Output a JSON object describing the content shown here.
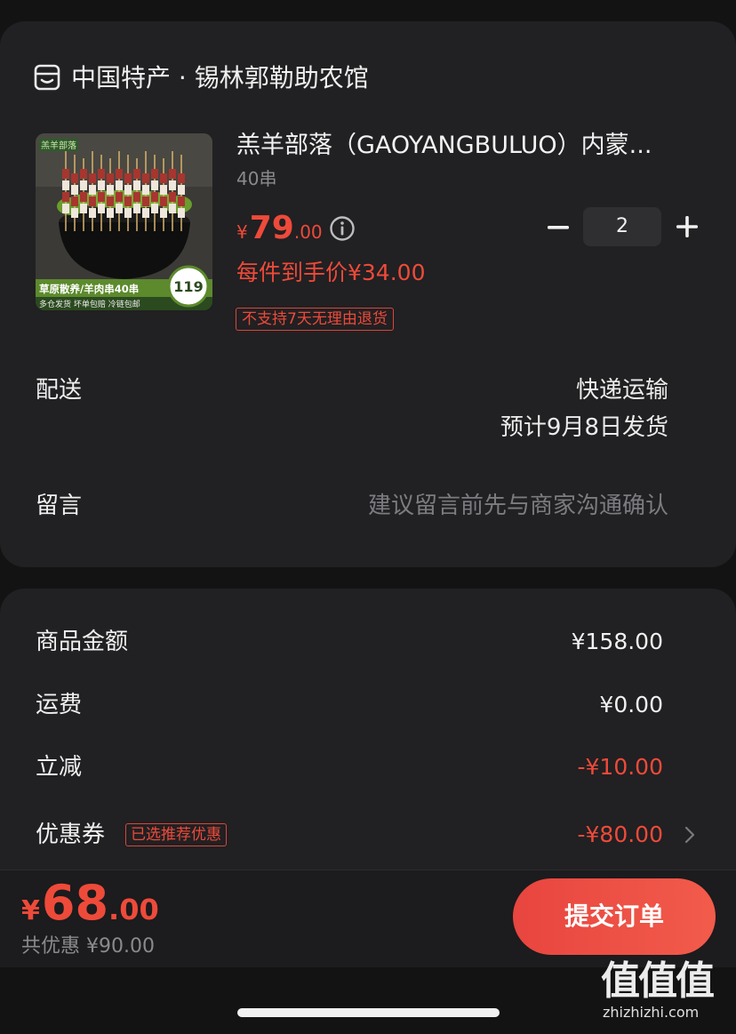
{
  "shop": {
    "icon": "store-icon",
    "name": "中国特产 · 锡林郭勒助农馆"
  },
  "product": {
    "title": "羔羊部落（GAOYANGBULUO）内蒙...",
    "spec": "40串",
    "price_symbol": "¥",
    "price_int": "79",
    "price_dec": ".00",
    "unit_price": "每件到手价¥34.00",
    "return_policy": "不支持7天无理由退货",
    "quantity": "2",
    "image": {
      "brand_text": "羔羊部落",
      "banner_text": "草原散养/羊肉串40串",
      "footer_text": "多仓发货 坏单包赔 冷链包邮",
      "badge_number": "119"
    }
  },
  "delivery": {
    "label": "配送",
    "method": "快递运输",
    "eta": "预计9月8日发货"
  },
  "note": {
    "label": "留言",
    "placeholder": "建议留言前先与商家沟通确认"
  },
  "summary": {
    "goods_label": "商品金额",
    "goods_value": "¥158.00",
    "shipping_label": "运费",
    "shipping_value": "¥0.00",
    "discount_label": "立减",
    "discount_value": "-¥10.00",
    "coupon_label": "优惠券",
    "coupon_badge": "已选推荐优惠",
    "coupon_value": "-¥80.00"
  },
  "footer": {
    "total_symbol": "¥",
    "total_int": "68",
    "total_dec": ".00",
    "saved": "共优惠 ¥90.00",
    "submit_label": "提交订单"
  },
  "watermark": {
    "logo": "值值值",
    "url": "zhizhizhi.com"
  },
  "colors": {
    "background": "#141314",
    "card": "#212022",
    "accent_red": "#ee4a3a",
    "muted_text": "#8a8a8c"
  }
}
